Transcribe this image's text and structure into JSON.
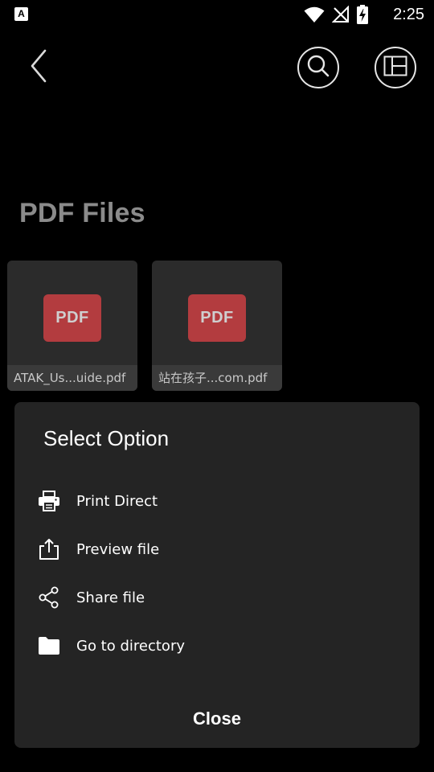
{
  "status_bar": {
    "app_icon_letter": "A",
    "time": "2:25",
    "icons": [
      "wifi-icon",
      "no-signal-icon",
      "battery-charging-icon"
    ]
  },
  "header": {
    "back_icon": "chevron-left-icon",
    "search_icon": "search-icon",
    "layout_icon": "layout-icon"
  },
  "page": {
    "title": "PDF Files"
  },
  "files": [
    {
      "badge": "PDF",
      "name": "ATAK_Us...uide.pdf"
    },
    {
      "badge": "PDF",
      "name": "站在孩子...com.pdf"
    }
  ],
  "dialog": {
    "title": "Select Option",
    "options": [
      {
        "label": "Print Direct",
        "icon": "printer-icon"
      },
      {
        "label": "Preview file",
        "icon": "upload-icon"
      },
      {
        "label": "Share file",
        "icon": "share-icon"
      },
      {
        "label": "Go to directory",
        "icon": "folder-icon"
      }
    ],
    "close_label": "Close"
  },
  "colors": {
    "background": "#000000",
    "card": "#2b2b2b",
    "dialog": "#242424",
    "pdf_badge": "#b33c3f",
    "title_gray": "#8b8b8b"
  }
}
